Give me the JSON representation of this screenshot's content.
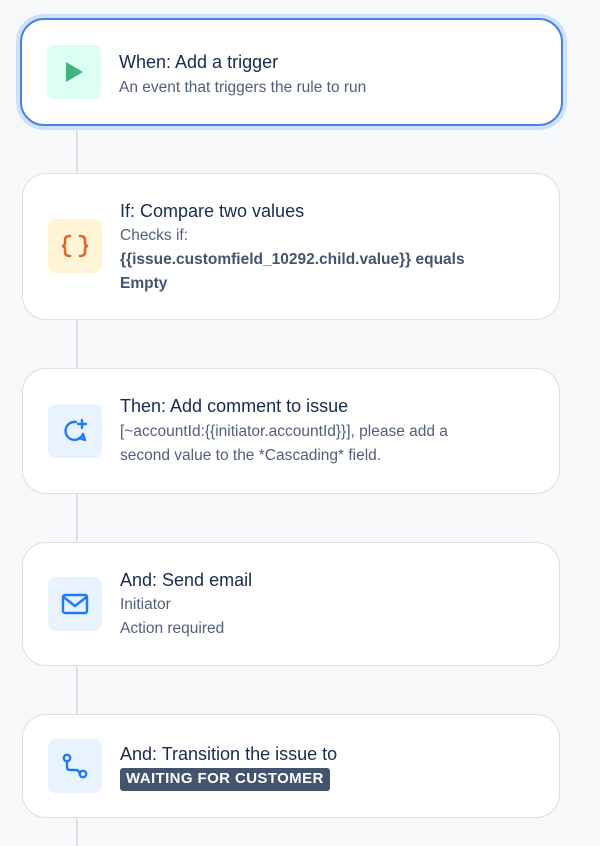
{
  "steps": [
    {
      "title": "When: Add a trigger",
      "description": "An event that triggers the rule to run",
      "icon": "play-icon",
      "icon_bg": "#dcfff1",
      "icon_color": "#3fb27f",
      "selected": true
    },
    {
      "title": "If: Compare two values",
      "description_label": "Checks if:",
      "description_expr": "{{issue.customfield_10292.child.value}} equals",
      "description_expr2": "Empty",
      "icon": "curly-braces-icon",
      "icon_bg": "#fff4d6",
      "icon_color": "#e2622a"
    },
    {
      "title": "Then: Add comment to issue",
      "description_line1": "[~accountId:{{initiator.accountId}}], please add a",
      "description_line2": "second value to the *Cascading* field.",
      "icon": "comment-add-icon",
      "icon_bg": "#e9f2ff",
      "icon_color": "#1d7afc"
    },
    {
      "title": "And: Send email",
      "description_line1": "Initiator",
      "description_line2": "Action required",
      "icon": "email-icon",
      "icon_bg": "#e9f2ff",
      "icon_color": "#1d7afc"
    },
    {
      "title": "And: Transition the issue to",
      "status_badge": "WAITING FOR CUSTOMER",
      "icon": "transition-icon",
      "icon_bg": "#e9f2ff",
      "icon_color": "#1d7afc"
    }
  ]
}
